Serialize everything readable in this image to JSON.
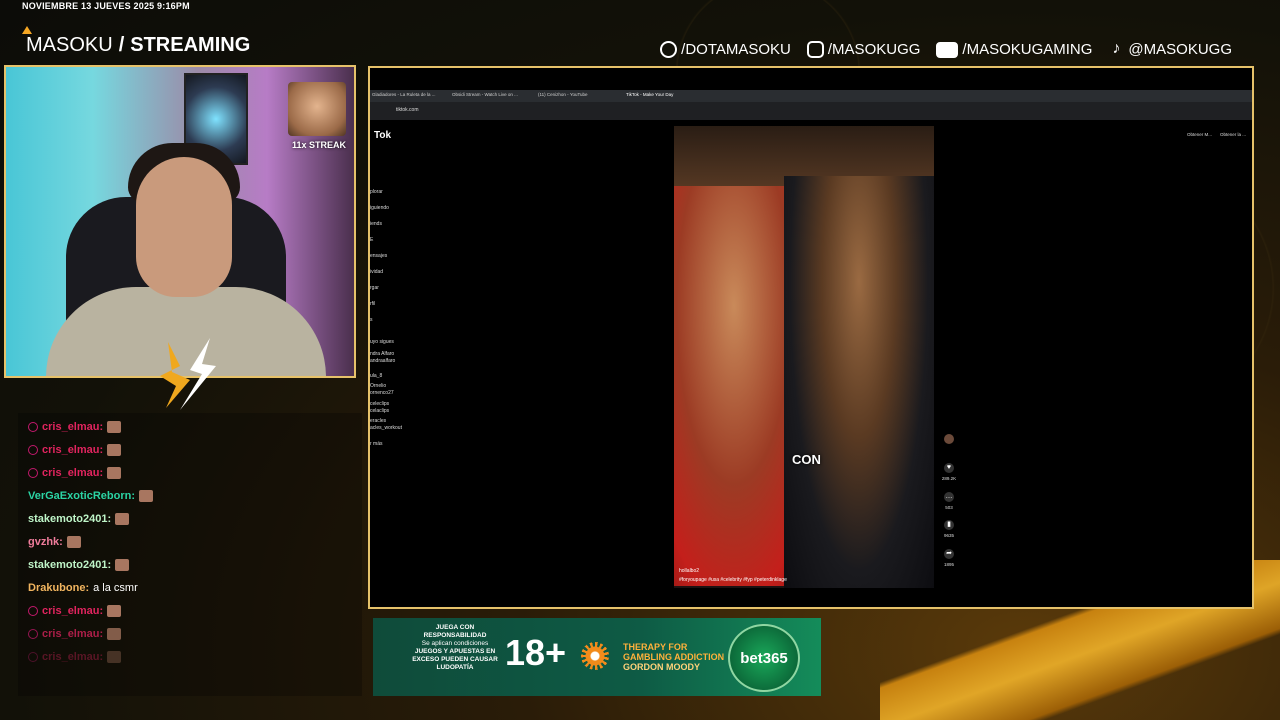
{
  "overlay": {
    "datetime": "NOVIEMBRE 13 JUEVES 2025 9:16PM",
    "brand_name": "MASOKU",
    "brand_sep": "/",
    "brand_suffix": "STREAMING",
    "socials": [
      {
        "icon": "facebook-icon",
        "label": "/DOTAMASOKU"
      },
      {
        "icon": "instagram-icon",
        "label": "/MASOKUGG"
      },
      {
        "icon": "youtube-icon",
        "label": "/MASOKUGAMING"
      },
      {
        "icon": "tiktok-icon",
        "label": "@MASOKUGG"
      }
    ],
    "streak": "11x STREAK"
  },
  "chat": [
    {
      "user": "cris_elmau:",
      "color": "#e0245e",
      "text": "",
      "badge": true
    },
    {
      "user": "cris_elmau:",
      "color": "#e0245e",
      "text": "",
      "badge": true
    },
    {
      "user": "cris_elmau:",
      "color": "#e0245e",
      "text": "",
      "badge": true
    },
    {
      "user": "VerGaExoticReborn:",
      "color": "#2bd4a4",
      "text": "",
      "badge": false
    },
    {
      "user": "stakemoto2401:",
      "color": "#bff5c8",
      "text": "",
      "badge": false
    },
    {
      "user": "gvzhk:",
      "color": "#f07c9b",
      "text": "",
      "badge": false
    },
    {
      "user": "stakemoto2401:",
      "color": "#bff5c8",
      "text": "",
      "badge": false
    },
    {
      "user": "Drakubone:",
      "color": "#f2b55f",
      "text": "a la csmr",
      "badge": false
    },
    {
      "user": "cris_elmau:",
      "color": "#e0245e",
      "text": "",
      "badge": true
    },
    {
      "user": "cris_elmau:",
      "color": "#e0245e",
      "text": "",
      "badge": true
    },
    {
      "user": "cris_elmau:",
      "color": "#e0245e",
      "text": "",
      "badge": true
    }
  ],
  "browser": {
    "tabs": [
      "Gladiadores - La Ruleta de la ...",
      "Obsidi Stream - Watch Live on ...",
      "(11) Cenizhon - YouTube",
      "TikTok - Make Your Day"
    ],
    "url": "tiktok.com",
    "logo": "Tok",
    "sidebar": [
      "plorar",
      "iguiendo",
      "iends",
      "E",
      "ensajes",
      "ividad",
      "rgar",
      "rfil",
      "s",
      "uyo sigues",
      "ndra Alfaro",
      "andraalfaro",
      "ula_8",
      "Ornelio",
      "ornenco27",
      "celeclips",
      "celaclips",
      "eracles",
      "acles_workout",
      "r más"
    ],
    "caption": "CON",
    "video_user": "hollalbo2",
    "video_tags": "#foryoupage #usa #celebrity #fyp #peterdinklage",
    "actions": [
      {
        "icon": "heart-icon",
        "count": "289.2K"
      },
      {
        "icon": "comment-icon",
        "count": "503"
      },
      {
        "icon": "bookmark-icon",
        "count": "9635"
      },
      {
        "icon": "share-icon",
        "count": "1895"
      }
    ],
    "obtener": [
      "Obtener M...",
      "Obtener la ..."
    ]
  },
  "banner": {
    "resp_title": "JUEGA CON RESPONSABILIDAD",
    "resp_sub": "Se aplican condiciones",
    "resp_warn": "JUEGOS Y APUESTAS EN EXCESO PUEDEN CAUSAR LUDOPATÍA",
    "age": "18+",
    "therapy_line1": "THERAPY FOR",
    "therapy_line2": "GAMBLING ADDICTION",
    "therapy_line3": "GORDON MOODY",
    "bet": "bet365"
  }
}
